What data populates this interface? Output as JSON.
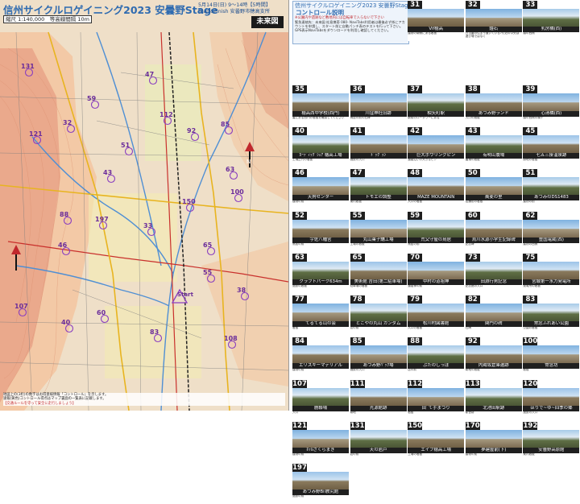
{
  "map": {
    "title": "信州サイクルロゲイニング2023 安曇野Stage",
    "scale": "縮尺 1:140,000　等高線間隔 10m",
    "date_line1": "5月14日(日) 9〜14時【5時間】",
    "date_line2": "Start&Finish 安曇野市穂高支所",
    "logo": "未来図",
    "start_label": "Start",
    "footer_line1": "地図上の(3桁)の数字はお得意様情報「コントロール」を示します。",
    "footer_line2": "速報(黄色)コントロール得点はマップ裏面の一覧表に記載します。",
    "footer_red": "【交通ルールを守って安全に走行しましょう】",
    "controls": [
      {
        "n": "131"
      },
      {
        "n": "59"
      },
      {
        "n": "47"
      },
      {
        "n": "32"
      },
      {
        "n": "121"
      },
      {
        "n": "51"
      },
      {
        "n": "88"
      },
      {
        "n": "46"
      },
      {
        "n": "197"
      },
      {
        "n": "33"
      },
      {
        "n": "112"
      },
      {
        "n": "92"
      },
      {
        "n": "85"
      },
      {
        "n": "63"
      },
      {
        "n": "100"
      },
      {
        "n": "43"
      },
      {
        "n": "150"
      },
      {
        "n": "55"
      },
      {
        "n": "38"
      },
      {
        "n": "107"
      },
      {
        "n": "60"
      },
      {
        "n": "83"
      },
      {
        "n": "40"
      },
      {
        "n": "108"
      },
      {
        "n": "65"
      }
    ]
  },
  "sheet": {
    "intro_title": "信州サイクルロゲイニング2023 安曇野Stage",
    "intro_sub": "コントロール説明",
    "intro_note": "※公園内や遺跡など敷地内には自転車で入らないで下さい",
    "intro_text": "緊急連絡先：未来図 松島携帯 080-\nNaviTabs利用者は最後必ず係にアカウントを申請し、スタート前に自動パンチ表のテストを行って下さい。GPS表示NaviTabsをダウンロードを利用し確認してください。",
    "cells": [
      {
        "n": "31",
        "name": "Vif穂高",
        "desc": "建物の南側にある看板"
      },
      {
        "n": "32",
        "name": "鐘石",
        "desc": "日当番の住まう置いている?付近の中央は遊び場ではなく"
      },
      {
        "n": "33",
        "name": "乳房橋(西)",
        "desc": "橋の西側"
      },
      {
        "n": "35",
        "name": "穂高西中学校(西門)",
        "desc": "裏にある西門の看板を確認してください"
      },
      {
        "n": "36",
        "name": "川窪神社旧跡",
        "desc": "鳥居の前の石碑"
      },
      {
        "n": "37",
        "name": "柏矢町駅",
        "desc": "駅前のロータリーにある"
      },
      {
        "n": "38",
        "name": "あづみ野ランド",
        "desc": "入口の看板"
      },
      {
        "n": "39",
        "name": "心清橋(西)",
        "desc": "橋の西側の欄干"
      },
      {
        "n": "40",
        "name": "ｶｰﾃﾞｨｯｸﾞｼｪｱ 穂高工場",
        "desc": "工場正門の看板"
      },
      {
        "n": "41",
        "name": "ﾄﾞｯｸﾞﾗﾝ",
        "desc": "施設の入口"
      },
      {
        "n": "42",
        "name": "巨大ボウリングピン",
        "desc": "道路沿いの大きなピン"
      },
      {
        "n": "43",
        "name": "有明山農場",
        "desc": "農場の看板"
      },
      {
        "n": "45",
        "name": "七五三掛温泉跡",
        "desc": "跡地の看板"
      },
      {
        "n": "46",
        "name": "天狗センター",
        "desc": "建物の前"
      },
      {
        "n": "47",
        "name": "トモエの調整",
        "desc": "案内看板"
      },
      {
        "n": "48",
        "name": "MAZE MOUNTAIN",
        "desc": "入口の看板"
      },
      {
        "n": "50",
        "name": "蕎麦の里",
        "desc": "店舗前の看板"
      },
      {
        "n": "51",
        "name": "あづみのDS1483",
        "desc": "建物の前"
      },
      {
        "n": "52",
        "name": "宇佐八幡宮",
        "desc": "鳥居の前"
      },
      {
        "n": "55",
        "name": "丸山菓子舗工場",
        "desc": "工場の看板"
      },
      {
        "n": "59",
        "name": "荒父守屋の鳥居",
        "desc": "鳥居の前"
      },
      {
        "n": "60",
        "name": "烏川水源小学生記録碑",
        "desc": "記念碑"
      },
      {
        "n": "62",
        "name": "豊国電蔵(西)",
        "desc": "建物の西側"
      },
      {
        "n": "63",
        "name": "クラフトパーク634m",
        "desc": "施設の看板"
      },
      {
        "n": "65",
        "name": "美術館 吉田(第二駐車場)",
        "desc": "駐車場の看板"
      },
      {
        "n": "70",
        "name": "中村の道祖神",
        "desc": "道祖神の前"
      },
      {
        "n": "73",
        "name": "田淵行男記念",
        "desc": "記念館の入口"
      },
      {
        "n": "75",
        "name": "宮城第一水力発電所",
        "desc": "発電所の看板"
      },
      {
        "n": "77",
        "name": "てるてる山の会",
        "desc": "看板"
      },
      {
        "n": "78",
        "name": "とこやの丸山 ガンダム",
        "desc": "店の前"
      },
      {
        "n": "79",
        "name": "松川村図書館",
        "desc": "入口の看板"
      },
      {
        "n": "82",
        "name": "関門の碑",
        "desc": "石碑"
      },
      {
        "n": "83",
        "name": "常念ふれあい公園",
        "desc": "公園の看板"
      },
      {
        "n": "84",
        "name": "エリスキーマテリアル",
        "desc": "建物の前"
      },
      {
        "n": "85",
        "name": "あづみ野ﾊﾟｯｸ場",
        "desc": "施設の入口"
      },
      {
        "n": "88",
        "name": "ぶたのしっぽ",
        "desc": "店の前"
      },
      {
        "n": "92",
        "name": "内蔵坂倉庫遺跡",
        "desc": "跡地の看板"
      },
      {
        "n": "100",
        "name": "常念坊",
        "desc": "看板"
      },
      {
        "n": "107",
        "name": "鹿聯場",
        "desc": "入口"
      },
      {
        "n": "111",
        "name": "光源館跡",
        "desc": "跡地"
      },
      {
        "n": "112",
        "name": "田ﾞて手まつり",
        "desc": "看板"
      },
      {
        "n": "113",
        "name": "北池田駅跡",
        "desc": "駅舎跡"
      },
      {
        "n": "120",
        "name": "ほりで~ゆ~四季の郷",
        "desc": "施設の入口"
      },
      {
        "n": "121",
        "name": "ﾎﾃﾙさくらまき",
        "desc": "建物の前"
      },
      {
        "n": "131",
        "name": "天の岩戸",
        "desc": "岩の前"
      },
      {
        "n": "150",
        "name": "エイブ穂高工場",
        "desc": "工場の看板"
      },
      {
        "n": "170",
        "name": "夢建屋前(下)",
        "desc": "建物の前"
      },
      {
        "n": "192",
        "name": "安曇野高原館",
        "desc": "案内看板"
      },
      {
        "n": "197",
        "name": "あづみ野Bil教究館",
        "desc": "施設の前"
      }
    ]
  }
}
